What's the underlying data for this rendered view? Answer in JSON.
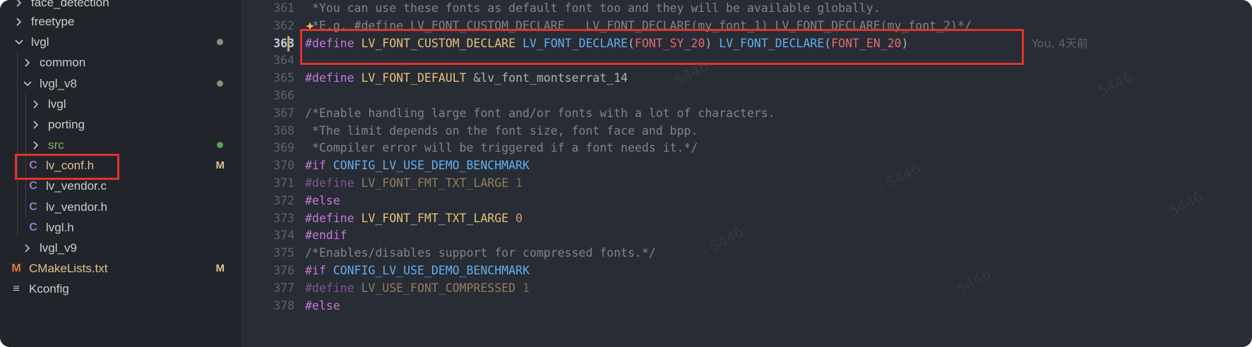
{
  "explorer": {
    "items": [
      {
        "name": "face_detection",
        "kind": "folder",
        "state": "collapsed",
        "depth": 0,
        "mark": ""
      },
      {
        "name": "freetype",
        "kind": "folder",
        "state": "collapsed",
        "depth": 0,
        "mark": ""
      },
      {
        "name": "lvgl",
        "kind": "folder",
        "state": "expanded",
        "depth": 0,
        "mark": "dot-gray"
      },
      {
        "name": "common",
        "kind": "folder",
        "state": "collapsed",
        "depth": 1,
        "mark": ""
      },
      {
        "name": "lvgl_v8",
        "kind": "folder",
        "state": "expanded",
        "depth": 1,
        "mark": "dot-gray"
      },
      {
        "name": "lvgl",
        "kind": "folder",
        "state": "collapsed",
        "depth": 2,
        "mark": ""
      },
      {
        "name": "porting",
        "kind": "folder",
        "state": "collapsed",
        "depth": 2,
        "mark": ""
      },
      {
        "name": "src",
        "kind": "folder",
        "state": "collapsed",
        "depth": 2,
        "mark": "dot-green"
      },
      {
        "name": "lv_conf.h",
        "kind": "c-file",
        "state": "",
        "depth": 2,
        "mark": "M"
      },
      {
        "name": "lv_vendor.c",
        "kind": "c-file",
        "state": "",
        "depth": 2,
        "mark": ""
      },
      {
        "name": "lv_vendor.h",
        "kind": "c-file",
        "state": "",
        "depth": 2,
        "mark": ""
      },
      {
        "name": "lvgl.h",
        "kind": "c-file",
        "state": "",
        "depth": 2,
        "mark": ""
      },
      {
        "name": "lvgl_v9",
        "kind": "folder",
        "state": "collapsed",
        "depth": 1,
        "mark": ""
      },
      {
        "name": "CMakeLists.txt",
        "kind": "cmake-file",
        "state": "",
        "depth": 0,
        "mark": "M"
      },
      {
        "name": "Kconfig",
        "kind": "text-file",
        "state": "",
        "depth": 0,
        "mark": ""
      }
    ],
    "colors": {
      "folder": "#cccccc",
      "modified": "#e2c08d",
      "untracked_dot": "#5a9e5a",
      "dot": "#8a8f7e",
      "c_icon": "#a074c4",
      "m_icon": "#e37933"
    }
  },
  "editor": {
    "line_numbers": [
      "361",
      "362",
      "363",
      "364",
      "365",
      "366",
      "367",
      "368",
      "369",
      "370",
      "371",
      "372",
      "373",
      "374",
      "375",
      "376",
      "377",
      "378"
    ],
    "current_line": "363",
    "blame": "You, 4天前",
    "lines": [
      [
        {
          "t": " *You can use these fonts as default font too and they will be available globally.",
          "c": "cmt"
        }
      ],
      [
        {
          "t": " *E.g. #define LV_FONT_CUSTOM_DECLARE   LV_FONT_DECLARE(my_font_1) LV_FONT_DECLARE(my_font_2)*/",
          "c": "cmt"
        }
      ],
      [
        {
          "t": "#define",
          "c": "macro"
        },
        {
          "t": " ",
          "c": "plain"
        },
        {
          "t": "LV_FONT_CUSTOM_DECLARE",
          "c": "id"
        },
        {
          "t": " ",
          "c": "plain"
        },
        {
          "t": "LV_FONT_DECLARE",
          "c": "fn"
        },
        {
          "t": "(",
          "c": "plain"
        },
        {
          "t": "FONT_SY_20",
          "c": "arg"
        },
        {
          "t": ")",
          "c": "plain"
        },
        {
          "t": " ",
          "c": "plain"
        },
        {
          "t": "LV_FONT_DECLARE",
          "c": "fn"
        },
        {
          "t": "(",
          "c": "plain"
        },
        {
          "t": "FONT_EN_20",
          "c": "arg"
        },
        {
          "t": ")",
          "c": "plain"
        }
      ],
      [],
      [
        {
          "t": "#define",
          "c": "macro"
        },
        {
          "t": " ",
          "c": "plain"
        },
        {
          "t": "LV_FONT_DEFAULT",
          "c": "id"
        },
        {
          "t": " &lv_font_montserrat_14",
          "c": "plain"
        }
      ],
      [],
      [
        {
          "t": "/*Enable handling large font and/or fonts with a lot of characters.",
          "c": "cmt"
        }
      ],
      [
        {
          "t": " *The limit depends on the font size, font face and bpp.",
          "c": "cmt"
        }
      ],
      [
        {
          "t": " *Compiler error will be triggered if a font needs it.*/",
          "c": "cmt"
        }
      ],
      [
        {
          "t": "#if",
          "c": "macro"
        },
        {
          "t": " ",
          "c": "plain"
        },
        {
          "t": "CONFIG_LV_USE_DEMO_BENCHMARK",
          "c": "fn"
        }
      ],
      [
        {
          "t": "#define",
          "c": "macro dim"
        },
        {
          "t": " ",
          "c": "plain"
        },
        {
          "t": "LV_FONT_FMT_TXT_LARGE",
          "c": "id dim"
        },
        {
          "t": " ",
          "c": "plain"
        },
        {
          "t": "1",
          "c": "num dim"
        }
      ],
      [
        {
          "t": "#else",
          "c": "macro"
        }
      ],
      [
        {
          "t": "#define",
          "c": "macro"
        },
        {
          "t": " ",
          "c": "plain"
        },
        {
          "t": "LV_FONT_FMT_TXT_LARGE",
          "c": "id"
        },
        {
          "t": " ",
          "c": "plain"
        },
        {
          "t": "0",
          "c": "num"
        }
      ],
      [
        {
          "t": "#endif",
          "c": "macro"
        }
      ],
      [
        {
          "t": "/*Enables/disables support for compressed fonts.*/",
          "c": "cmt"
        }
      ],
      [
        {
          "t": "#if",
          "c": "macro"
        },
        {
          "t": " ",
          "c": "plain"
        },
        {
          "t": "CONFIG_LV_USE_DEMO_BENCHMARK",
          "c": "fn"
        }
      ],
      [
        {
          "t": "#define",
          "c": "macro dim"
        },
        {
          "t": " ",
          "c": "plain"
        },
        {
          "t": "LV_USE_FONT_COMPRESSED",
          "c": "id dim"
        },
        {
          "t": " ",
          "c": "plain"
        },
        {
          "t": "1",
          "c": "num dim"
        }
      ],
      [
        {
          "t": "#else",
          "c": "macro"
        }
      ]
    ]
  }
}
